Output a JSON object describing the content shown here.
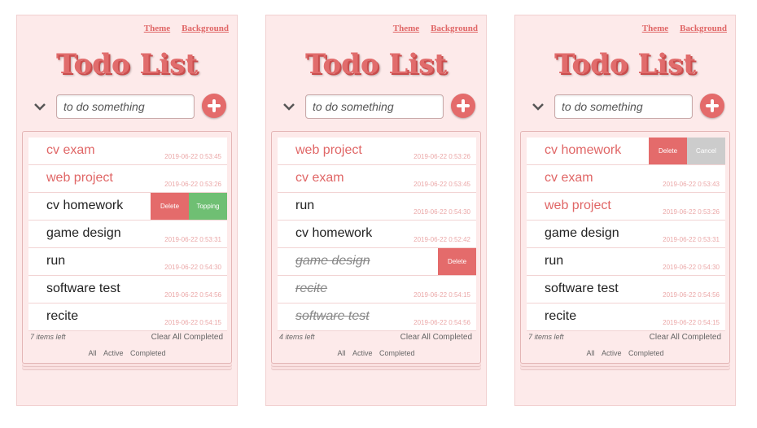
{
  "panels": [
    {
      "nav": {
        "theme": "Theme",
        "background": "Background"
      },
      "title": "Todo List",
      "input_placeholder": "to do something",
      "items": [
        {
          "text": "cv exam",
          "time": "2019-06-22 0:53:45",
          "style": "hl"
        },
        {
          "text": "web project",
          "time": "2019-06-22 0:53:26",
          "style": "hl"
        },
        {
          "text": "cv homework",
          "time": "",
          "style": "",
          "buttons": [
            "Delete",
            "Topping"
          ]
        },
        {
          "text": "game design",
          "time": "2019-06-22 0:53:31",
          "style": ""
        },
        {
          "text": "run",
          "time": "2019-06-22 0:54:30",
          "style": ""
        },
        {
          "text": "software test",
          "time": "2019-06-22 0:54:56",
          "style": ""
        },
        {
          "text": "recite",
          "time": "2019-06-22 0:54:15",
          "style": ""
        }
      ],
      "footer": {
        "left": "7 items left",
        "right": "Clear All Completed"
      },
      "filters": [
        "All",
        "Active",
        "Completed"
      ]
    },
    {
      "nav": {
        "theme": "Theme",
        "background": "Background"
      },
      "title": "Todo List",
      "input_placeholder": "to do something",
      "items": [
        {
          "text": "web project",
          "time": "2019-06-22 0:53:26",
          "style": "hl"
        },
        {
          "text": "cv exam",
          "time": "2019-06-22 0:53:45",
          "style": "hl"
        },
        {
          "text": "run",
          "time": "2019-06-22 0:54:30",
          "style": ""
        },
        {
          "text": "cv homework",
          "time": "2019-06-22 0:52:42",
          "style": ""
        },
        {
          "text": "game design",
          "time": "",
          "style": "done",
          "buttons": [
            "Delete"
          ]
        },
        {
          "text": "recite",
          "time": "2019-06-22 0:54:15",
          "style": "done"
        },
        {
          "text": "software test",
          "time": "2019-06-22 0:54:56",
          "style": "done"
        }
      ],
      "footer": {
        "left": "4 items left",
        "right": "Clear All Completed"
      },
      "filters": [
        "All",
        "Active",
        "Completed"
      ]
    },
    {
      "nav": {
        "theme": "Theme",
        "background": "Background"
      },
      "title": "Todo List",
      "input_placeholder": "to do something",
      "items": [
        {
          "text": "cv homework",
          "time": "",
          "style": "hl",
          "buttons": [
            "Delete",
            "Cancel"
          ]
        },
        {
          "text": "cv exam",
          "time": "2019-06-22 0:53:43",
          "style": "hl"
        },
        {
          "text": "web project",
          "time": "2019-06-22 0:53:26",
          "style": "hl"
        },
        {
          "text": "game design",
          "time": "2019-06-22 0:53:31",
          "style": ""
        },
        {
          "text": "run",
          "time": "2019-06-22 0:54:30",
          "style": ""
        },
        {
          "text": "software test",
          "time": "2019-06-22 0:54:56",
          "style": ""
        },
        {
          "text": "recite",
          "time": "2019-06-22 0:54:15",
          "style": ""
        }
      ],
      "footer": {
        "left": "7 items left",
        "right": "Clear All Completed"
      },
      "filters": [
        "All",
        "Active",
        "Completed"
      ]
    }
  ],
  "colors": {
    "accent": "#e46b6b",
    "topping": "#6fbf73",
    "cancel": "#cccccc",
    "panel_bg": "#fdeaea"
  }
}
